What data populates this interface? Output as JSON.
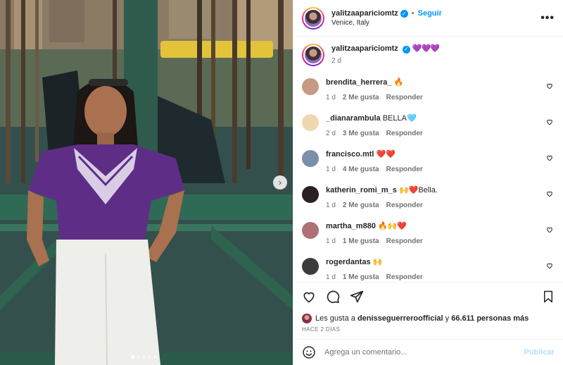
{
  "post": {
    "username": "yalitzaapariciomtz",
    "follow_label": "Seguir",
    "location": "Venice, Italy",
    "more_label": "•••",
    "separator": "•"
  },
  "caption": {
    "username": "yalitzaapariciomtz",
    "text": "💜💜💜",
    "time": "2 d"
  },
  "comments": [
    {
      "username": "brendita_herrera_",
      "text": "🔥",
      "time": "1 d",
      "likes": "2 Me gusta",
      "reply": "Responder",
      "avatar_color": "#c79a86"
    },
    {
      "username": "_dianarambula",
      "text": "BELLA🩵",
      "time": "2 d",
      "likes": "3 Me gusta",
      "reply": "Responder",
      "avatar_color": "#f0d7b0"
    },
    {
      "username": "francisco.mtl",
      "text": "❤️❤️",
      "time": "1 d",
      "likes": "4 Me gusta",
      "reply": "Responder",
      "avatar_color": "#7b8fa8"
    },
    {
      "username": "katherin_romi_m_s",
      "text": "🙌❤️Bella.",
      "time": "1 d",
      "likes": "2 Me gusta",
      "reply": "Responder",
      "avatar_color": "#2a1f22"
    },
    {
      "username": "martha_m880",
      "text": "🔥🙌❤️",
      "time": "1 d",
      "likes": "1 Me gusta",
      "reply": "Responder",
      "avatar_color": "#b07078"
    },
    {
      "username": "rogerdantas",
      "text": "🙌",
      "time": "1 d",
      "likes": "1 Me gusta",
      "reply": "Responder",
      "avatar_color": "#3b3b3b"
    }
  ],
  "likes": {
    "prefix": "Les gusta a",
    "user": "denisseguerreroofficial",
    "conj": "y",
    "count": "66.611 personas más"
  },
  "ago": "HACE 2 DÍAS",
  "add_comment": {
    "placeholder": "Agrega un comentario...",
    "publish_label": "Publicar"
  },
  "icons": {
    "like": "heart-icon",
    "comment": "comment-icon",
    "share": "share-icon",
    "save": "bookmark-icon",
    "emoji": "emoji-icon",
    "verified": "verified-badge-icon",
    "next": "chevron-right-icon"
  },
  "carousel": {
    "total": 5,
    "active": 1
  },
  "colors": {
    "accent": "#0095f6",
    "publish_disabled": "#b2dffc",
    "muted": "#737373"
  }
}
